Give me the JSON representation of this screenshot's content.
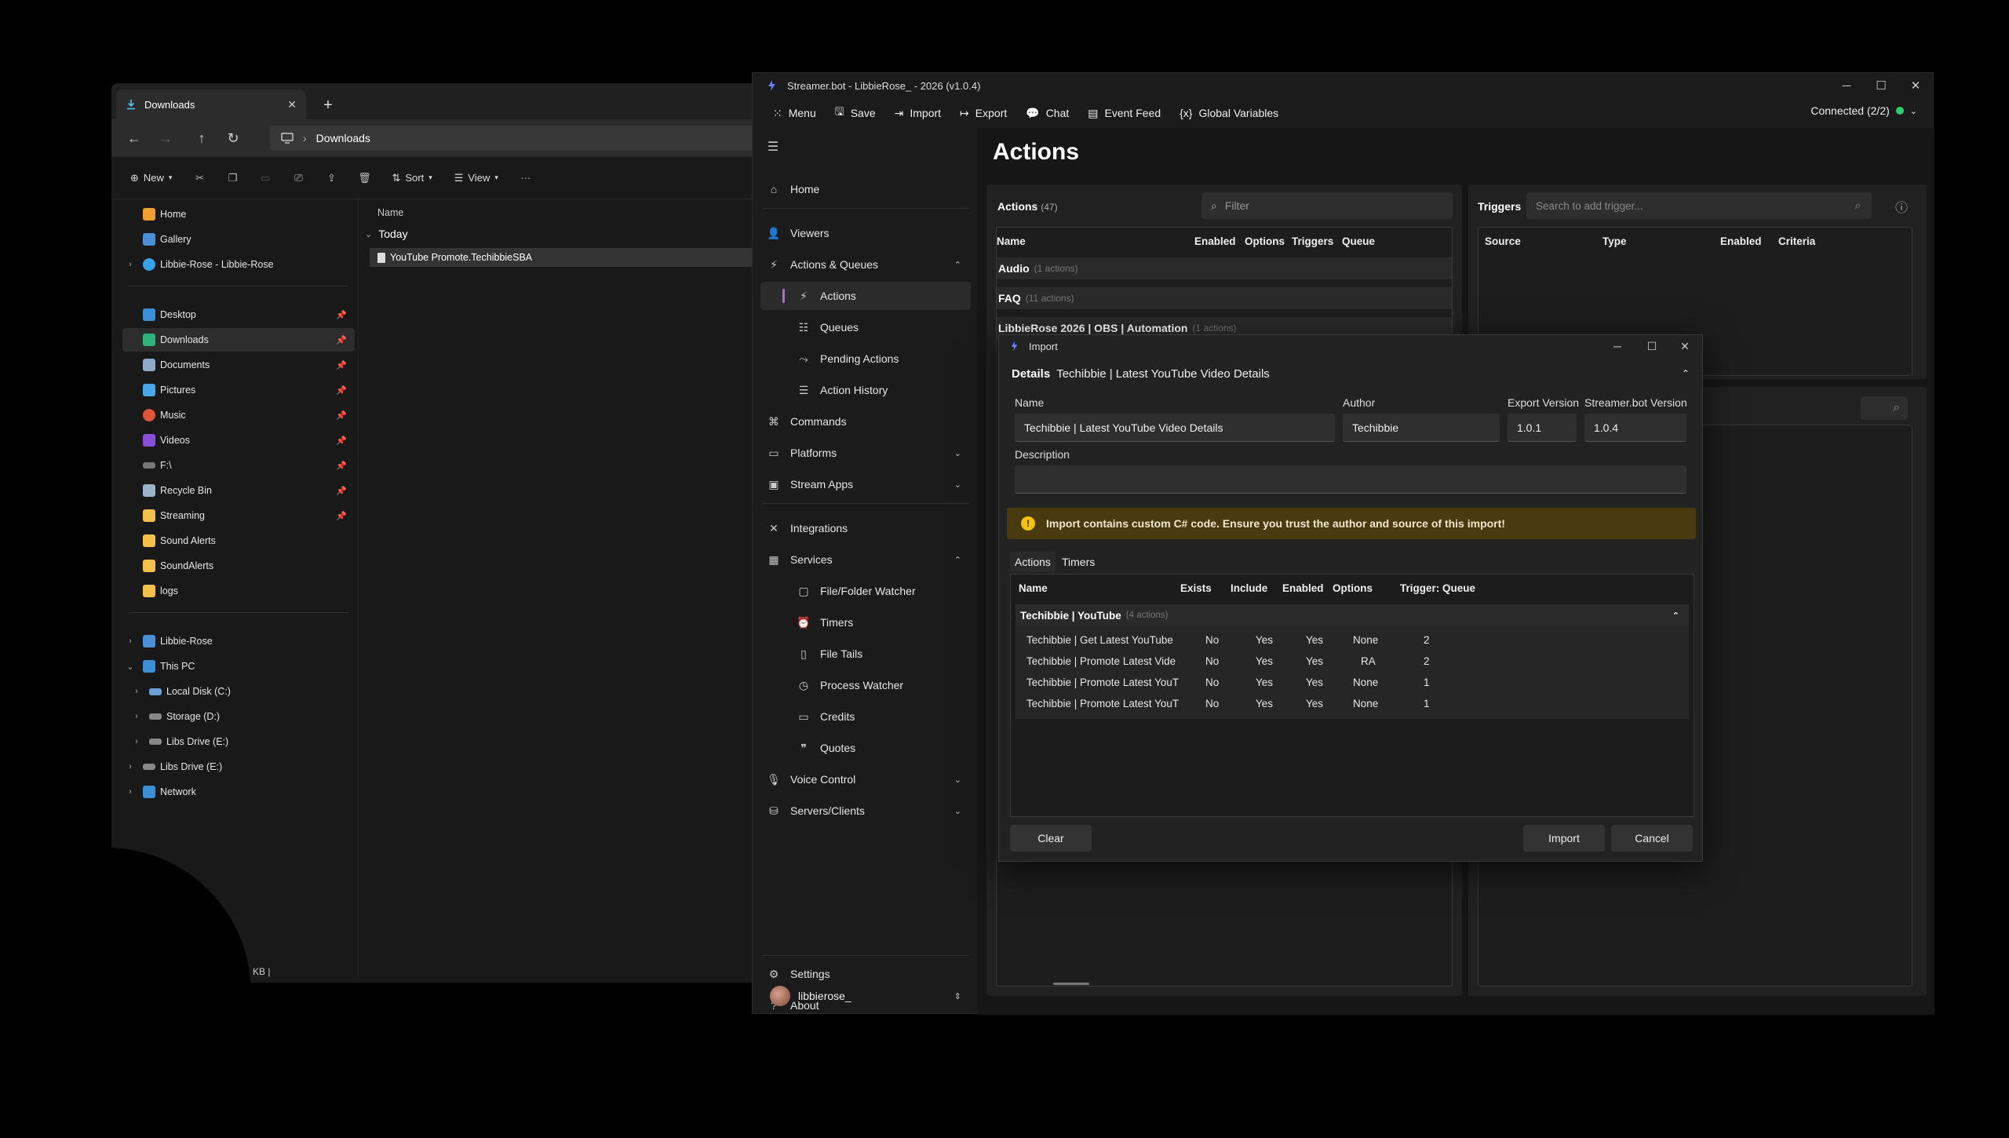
{
  "explorer": {
    "tab_title": "Downloads",
    "breadcrumb": "Downloads",
    "cmd": {
      "new": "New",
      "sort": "Sort",
      "view": "View"
    },
    "nav": {
      "home": "Home",
      "gallery": "Gallery",
      "cloud": "Libbie-Rose - Libbie-Rose",
      "desktop": "Desktop",
      "downloads": "Downloads",
      "documents": "Documents",
      "pictures": "Pictures",
      "music": "Music",
      "videos": "Videos",
      "f_drive": "F:\\",
      "recycle": "Recycle Bin",
      "streaming": "Streaming",
      "sound_alerts": "Sound Alerts",
      "soundalerts": "SoundAlerts",
      "logs": "logs",
      "libbie_rose": "Libbie-Rose",
      "this_pc": "This PC",
      "local_disk": "Local Disk (C:)",
      "storage": "Storage (D:)",
      "libs_drive_e1": "Libs Drive (E:)",
      "libs_drive_e2": "Libs Drive (E:)",
      "network": "Network"
    },
    "list": {
      "col_name": "Name",
      "group_today": "Today",
      "file_name": "YouTube Promote.TechibbieSBA"
    },
    "status": "KB  |"
  },
  "sb": {
    "title": "Streamer.bot - LibbieRose_ - 2026 (v1.0.4)",
    "menu": {
      "menu": "Menu",
      "save": "Save",
      "import": "Import",
      "export": "Export",
      "chat": "Chat",
      "event_feed": "Event Feed",
      "global_variables": "Global Variables"
    },
    "connection": "Connected (2/2)",
    "sidebar": {
      "home": "Home",
      "viewers": "Viewers",
      "actions_queues": "Actions & Queues",
      "actions": "Actions",
      "queues": "Queues",
      "pending_actions": "Pending Actions",
      "action_history": "Action History",
      "commands": "Commands",
      "platforms": "Platforms",
      "stream_apps": "Stream Apps",
      "integrations": "Integrations",
      "services": "Services",
      "file_folder_watcher": "File/Folder Watcher",
      "timers": "Timers",
      "file_tails": "File Tails",
      "process_watcher": "Process Watcher",
      "credits": "Credits",
      "quotes": "Quotes",
      "voice_control": "Voice Control",
      "servers_clients": "Servers/Clients",
      "settings": "Settings",
      "about": "About",
      "user": "libbierose_"
    },
    "page_title": "Actions",
    "actions_panel": {
      "title": "Actions",
      "count": "(47)",
      "filter_placeholder": "Filter",
      "cols": {
        "name": "Name",
        "enabled": "Enabled",
        "options": "Options",
        "triggers": "Triggers",
        "queue": "Queue"
      },
      "groups": [
        {
          "name": "Audio",
          "count": "(1 actions)"
        },
        {
          "name": "FAQ",
          "count": "(11 actions)"
        },
        {
          "name": "LibbieRose 2026 | OBS | Automation",
          "count": "(1 actions)"
        }
      ]
    },
    "triggers_panel": {
      "title": "Triggers",
      "search_placeholder": "Search to add trigger...",
      "cols": {
        "source": "Source",
        "type": "Type",
        "enabled": "Enabled",
        "criteria": "Criteria"
      }
    }
  },
  "import_dialog": {
    "title": "Import",
    "details_label": "Details",
    "details_name": "Techibbie | Latest YouTube Video Details",
    "labels": {
      "name": "Name",
      "author": "Author",
      "export_version": "Export Version",
      "sb_version": "Streamer.bot Version",
      "description": "Description"
    },
    "values": {
      "name": "Techibbie | Latest YouTube Video Details",
      "author": "Techibbie",
      "export_version": "1.0.1",
      "sb_version": "1.0.4",
      "description": ""
    },
    "warning": "Import contains custom C# code. Ensure you trust the author and source of this import!",
    "tabs": {
      "actions": "Actions",
      "timers": "Timers"
    },
    "table": {
      "cols": {
        "name": "Name",
        "exists": "Exists",
        "include": "Include",
        "enabled": "Enabled",
        "options": "Options",
        "trigger_queue": "Trigger: Queue"
      },
      "group": {
        "name": "Techibbie | YouTube",
        "count": "(4 actions)"
      },
      "rows": [
        {
          "name": "Techibbie | Get Latest YouTube",
          "exists": "No",
          "include": "Yes",
          "enabled": "Yes",
          "options": "None",
          "triggers": "2"
        },
        {
          "name": "Techibbie | Promote Latest Vide",
          "exists": "No",
          "include": "Yes",
          "enabled": "Yes",
          "options": "RA",
          "triggers": "2"
        },
        {
          "name": "Techibbie | Promote Latest YouT",
          "exists": "No",
          "include": "Yes",
          "enabled": "Yes",
          "options": "None",
          "triggers": "1"
        },
        {
          "name": "Techibbie | Promote Latest YouT",
          "exists": "No",
          "include": "Yes",
          "enabled": "Yes",
          "options": "None",
          "triggers": "1"
        }
      ]
    },
    "buttons": {
      "clear": "Clear",
      "import": "Import",
      "cancel": "Cancel"
    }
  },
  "colors": {
    "accent": "#b06adf",
    "connected": "#2ecc71",
    "warning_bg": "#4a3a10",
    "warning_icon": "#f1c40f"
  }
}
